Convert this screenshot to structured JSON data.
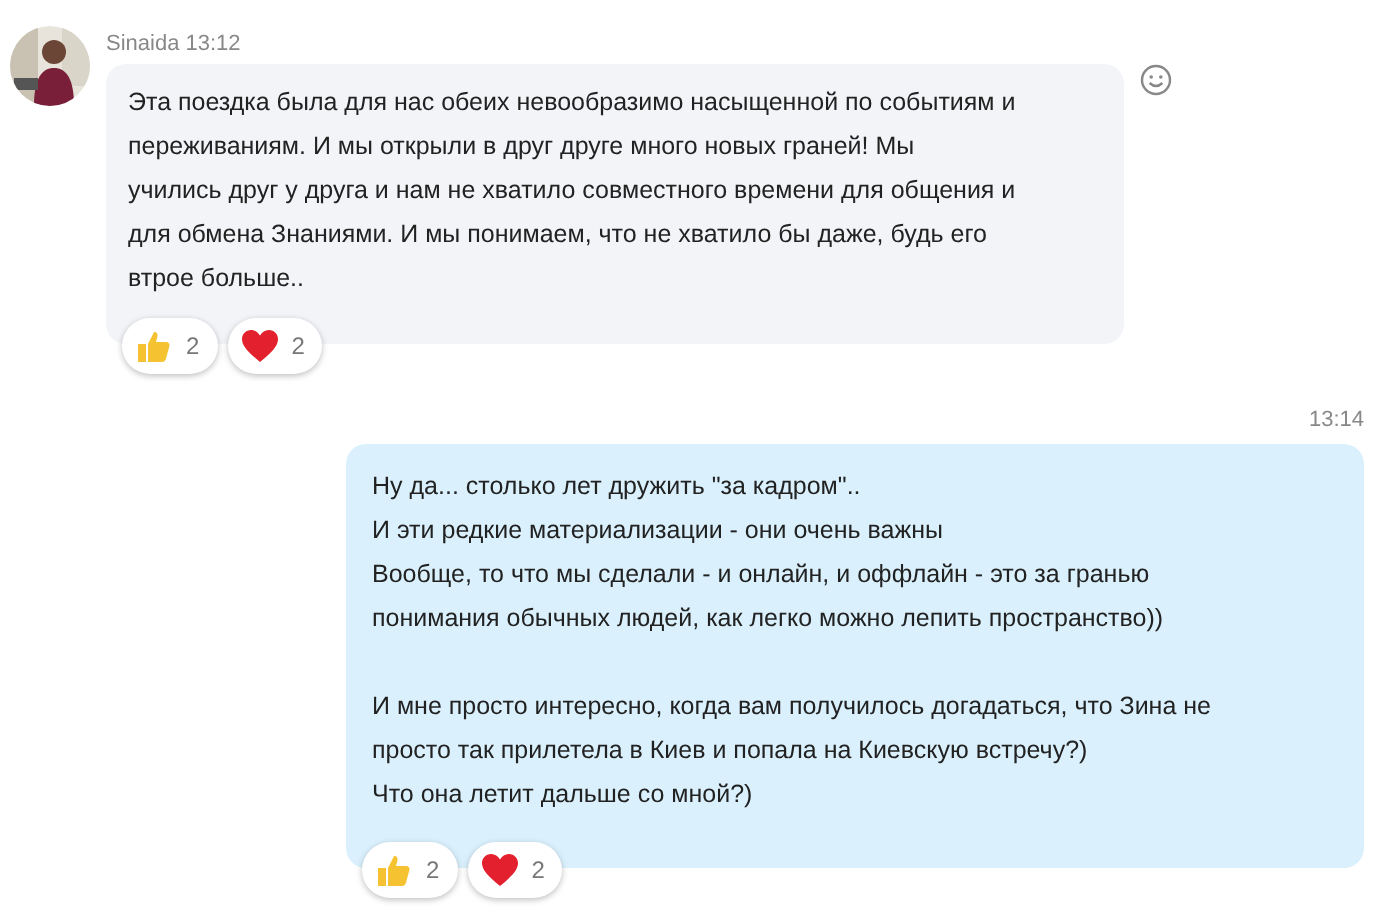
{
  "messages": [
    {
      "kind": "incoming",
      "sender": "Sinaida",
      "time": "13:12",
      "paragraphs": [
        "Эта поездка была для нас обеих невообразимо насыщенной по событиям и\nпереживаниям. И мы открыли в друг друге много новых граней! Мы\nучились друг у друга и нам не хватило совместного времени для общения и\nдля обмена Знаниями. И мы понимаем, что не хватило бы даже, будь его\nвтрое больше.."
      ],
      "reactions": [
        {
          "kind": "thumbs",
          "count": "2"
        },
        {
          "kind": "heart",
          "count": "2"
        }
      ]
    },
    {
      "kind": "outgoing",
      "time": "13:14",
      "paragraphs": [
        "Ну да... столько лет дружить \"за кадром\"..\nИ эти редкие материализации - они очень важны\nВообще, то что мы сделали - и онлайн, и оффлайн - это за гранью\nпонимания обычных людей, как легко можно лепить пространство))",
        "И мне просто интересно, когда вам получилось догадаться, что Зина не\nпросто так прилетела в Киев и попала на Киевскую встречу?)\nЧто она летит дальше со мной?)"
      ],
      "reactions": [
        {
          "kind": "thumbs",
          "count": "2"
        },
        {
          "kind": "heart",
          "count": "2"
        }
      ]
    }
  ]
}
